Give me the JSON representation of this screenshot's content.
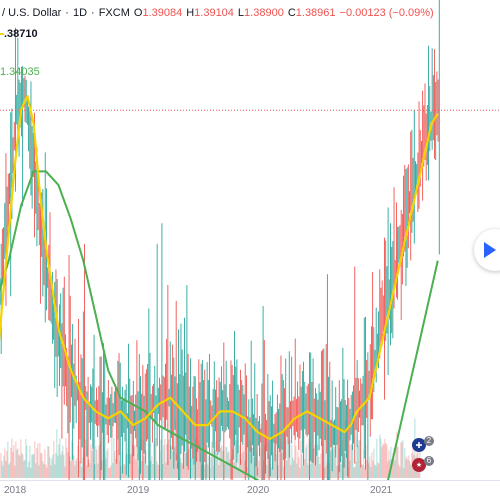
{
  "header": {
    "symbol": "/ U.S. Dollar",
    "interval": "1D",
    "exchange": "FXCM",
    "open_label": "O",
    "open": "1.39084",
    "high_label": "H",
    "high": "1.39104",
    "low_label": "L",
    "low": "1.38900",
    "close_label": "C",
    "close": "1.38961",
    "change": "−0.00123 (−0.09%)"
  },
  "indicators": {
    "ma_fast_value": ".38710",
    "ma_slow_value": "1.34035"
  },
  "colors": {
    "up": "#26a69a",
    "down": "#ef5350",
    "ma_fast": "#f5d300",
    "ma_slow": "#4caf50",
    "price_line": "#ef5350",
    "accent": "#2962ff"
  },
  "x_axis": {
    "ticks": [
      "2018",
      "2019",
      "2020",
      "2021"
    ]
  },
  "badges": {
    "uk_count": "2",
    "us_count": "6"
  },
  "chart_data": {
    "type": "line",
    "ylim": [
      1.15,
      1.45
    ],
    "ma_fast": [
      [
        2017.9,
        1.2
      ],
      [
        2017.95,
        1.25
      ],
      [
        2018.0,
        1.3
      ],
      [
        2018.05,
        1.35
      ],
      [
        2018.1,
        1.39
      ],
      [
        2018.15,
        1.4
      ],
      [
        2018.2,
        1.38
      ],
      [
        2018.25,
        1.33
      ],
      [
        2018.3,
        1.29
      ],
      [
        2018.35,
        1.26
      ],
      [
        2018.4,
        1.23
      ],
      [
        2018.5,
        1.2
      ],
      [
        2018.6,
        1.18
      ],
      [
        2018.7,
        1.17
      ],
      [
        2018.8,
        1.165
      ],
      [
        2018.9,
        1.17
      ],
      [
        2018.95,
        1.165
      ],
      [
        2019.0,
        1.16
      ],
      [
        2019.1,
        1.165
      ],
      [
        2019.2,
        1.175
      ],
      [
        2019.3,
        1.18
      ],
      [
        2019.4,
        1.17
      ],
      [
        2019.5,
        1.16
      ],
      [
        2019.6,
        1.16
      ],
      [
        2019.7,
        1.17
      ],
      [
        2019.8,
        1.17
      ],
      [
        2019.9,
        1.165
      ],
      [
        2020.0,
        1.155
      ],
      [
        2020.1,
        1.15
      ],
      [
        2020.2,
        1.155
      ],
      [
        2020.3,
        1.165
      ],
      [
        2020.4,
        1.17
      ],
      [
        2020.5,
        1.165
      ],
      [
        2020.6,
        1.16
      ],
      [
        2020.7,
        1.155
      ],
      [
        2020.75,
        1.16
      ],
      [
        2020.8,
        1.17
      ],
      [
        2020.9,
        1.18
      ],
      [
        2021.0,
        1.22
      ],
      [
        2021.1,
        1.26
      ],
      [
        2021.2,
        1.3
      ],
      [
        2021.3,
        1.34
      ],
      [
        2021.35,
        1.36
      ],
      [
        2021.4,
        1.38
      ],
      [
        2021.45,
        1.387
      ]
    ],
    "ma_slow": [
      [
        2017.9,
        1.25
      ],
      [
        2018.0,
        1.28
      ],
      [
        2018.1,
        1.32
      ],
      [
        2018.2,
        1.345
      ],
      [
        2018.3,
        1.345
      ],
      [
        2018.4,
        1.335
      ],
      [
        2018.5,
        1.31
      ],
      [
        2018.6,
        1.28
      ],
      [
        2018.7,
        1.24
      ],
      [
        2018.8,
        1.2
      ],
      [
        2018.9,
        1.18
      ],
      [
        2019.0,
        1.175
      ],
      [
        2019.1,
        1.17
      ],
      [
        2019.2,
        1.16
      ],
      [
        2019.3,
        1.155
      ],
      [
        2019.4,
        1.15
      ],
      [
        2019.5,
        1.145
      ],
      [
        2019.6,
        1.14
      ],
      [
        2019.8,
        1.13
      ],
      [
        2020.0,
        1.12
      ],
      [
        2020.2,
        1.11
      ],
      [
        2020.4,
        1.1
      ],
      [
        2020.6,
        1.09
      ],
      [
        2020.8,
        1.09
      ],
      [
        2021.0,
        1.1
      ],
      [
        2021.1,
        1.14
      ],
      [
        2021.2,
        1.18
      ],
      [
        2021.3,
        1.22
      ],
      [
        2021.45,
        1.28
      ]
    ],
    "price_line_value": 1.38961,
    "x_ticks": [
      "2018",
      "2019",
      "2020",
      "2021"
    ]
  }
}
